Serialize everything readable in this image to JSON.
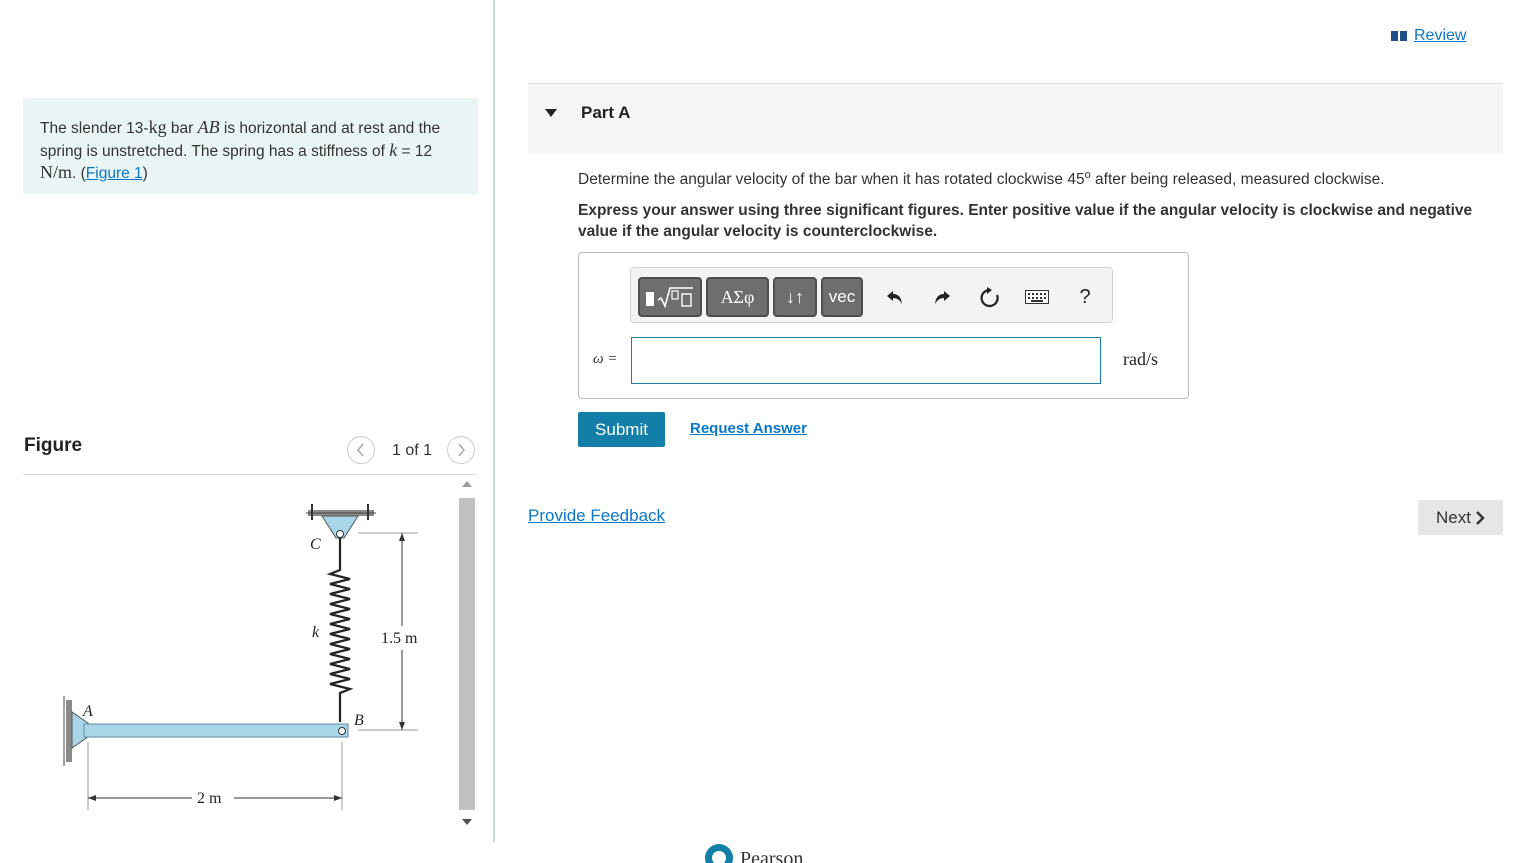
{
  "problem": {
    "t1": "The slender 13-",
    "t2": "kg",
    "t3": " bar ",
    "t4": "AB",
    "t5": " is horizontal and at rest and the spring is unstretched. The spring has a stiffness of ",
    "t6": "k",
    "t7": " = 12 ",
    "t8": "N/m",
    "t9": ". (",
    "link": "Figure 1",
    "t10": ")"
  },
  "figure": {
    "title": "Figure",
    "pager": "1 of 1",
    "labels": {
      "C": "C",
      "k": "k",
      "A": "A",
      "B": "B",
      "height": "1.5 m",
      "length": "2 m"
    }
  },
  "review": {
    "label": "Review"
  },
  "part": {
    "title": "Part A"
  },
  "question": {
    "text": "Determine the angular velocity of the bar when it has rotated clockwise 45",
    "degree": "o",
    "text_end": " after being released, measured clockwise.",
    "instructions": "Express your answer using three significant figures. Enter positive value if the angular velocity is clockwise and negative value if the angular velocity is counterclockwise."
  },
  "toolbar": {
    "templates_icon": "radical-template-icon",
    "greek_label": "ΑΣφ",
    "arrows_label": "↓↑",
    "vec_label": "vec",
    "undo_icon": "undo-icon",
    "redo_icon": "redo-icon",
    "reset_icon": "reset-icon",
    "keyboard_icon": "keyboard-icon",
    "help_label": "?"
  },
  "answer": {
    "variable": "ω =",
    "value": "",
    "unit": "rad/s"
  },
  "actions": {
    "submit": "Submit",
    "request": "Request Answer",
    "feedback": "Provide Feedback",
    "next": "Next"
  },
  "footer": {
    "logo": "Pearson"
  },
  "colors": {
    "accent": "#137fa8",
    "link": "#0b77c9",
    "problem_bg": "#e9f4f5",
    "bar": "#a9d5e8"
  }
}
